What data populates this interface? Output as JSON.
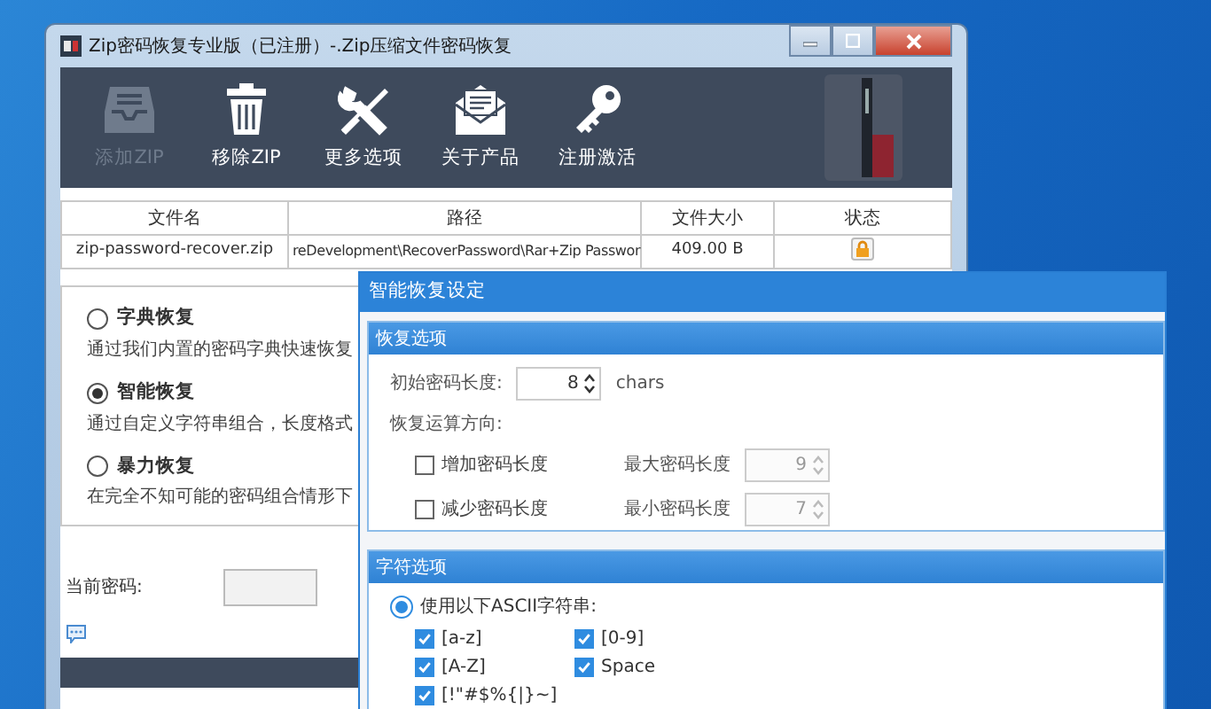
{
  "window": {
    "title": "Zip密码恢复专业版（已注册）-.Zip压缩文件密码恢复"
  },
  "toolbar": [
    {
      "label": "添加ZIP",
      "kind": "inbox",
      "disabled": true
    },
    {
      "label": "移除ZIP",
      "kind": "trash",
      "disabled": false
    },
    {
      "label": "更多选项",
      "kind": "tools",
      "disabled": false
    },
    {
      "label": "关于产品",
      "kind": "mail",
      "disabled": false
    },
    {
      "label": "注册激活",
      "kind": "key",
      "disabled": false
    }
  ],
  "table": {
    "columns": [
      "文件名",
      "路径",
      "文件大小",
      "状态"
    ],
    "rows": [
      {
        "cells": [
          "zip-password-recover.zip",
          "reDevelopment\\RecoverPassword\\Rar+Zip Passwor",
          "409.00 B"
        ],
        "locked": true
      }
    ]
  },
  "modes": [
    {
      "title": "字典恢复",
      "description": "通过我们内置的密码字典快速恢复",
      "selected": false
    },
    {
      "title": "智能恢复",
      "description": "通过自定义字符串组合，长度格式",
      "selected": true
    },
    {
      "title": "暴力恢复",
      "description": "在完全不知可能的密码组合情形下",
      "selected": false
    }
  ],
  "current_password": {
    "label": "当前密码:"
  },
  "dialog": {
    "title": "智能恢复设定",
    "recovery_options": {
      "heading": "恢复选项",
      "start_length": {
        "label": "初始密码长度:",
        "value": "8",
        "unit": "chars"
      },
      "direction_label": "恢复运算方向:",
      "directions": [
        {
          "label": "增加密码长度",
          "checked": false,
          "limit_label": "最大密码长度",
          "limit_value": "9",
          "limit_disabled": true
        },
        {
          "label": "减少密码长度",
          "checked": false,
          "limit_label": "最小密码长度",
          "limit_value": "7",
          "limit_disabled": true
        }
      ]
    },
    "charset": {
      "heading": "字符选项",
      "option": {
        "label": "使用以下ASCII字符串:",
        "selected": true
      },
      "sets": [
        {
          "label": "[a-z]",
          "checked": true
        },
        {
          "label": "[0-9]",
          "checked": true
        },
        {
          "label": "[A-Z]",
          "checked": true
        },
        {
          "label": "Space",
          "checked": true
        },
        {
          "label": "[!\"#$%{|}~]",
          "checked": true
        }
      ]
    }
  }
}
